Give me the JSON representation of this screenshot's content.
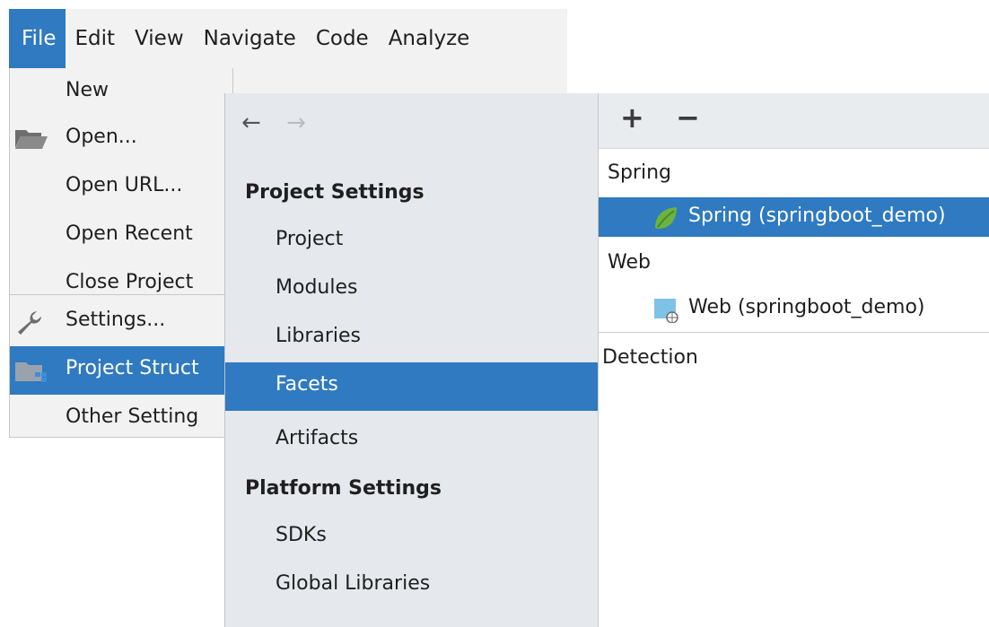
{
  "menubar": {
    "items": [
      "File",
      "Edit",
      "View",
      "Navigate",
      "Code",
      "Analyze"
    ]
  },
  "file_menu": {
    "new_label": "New",
    "open_label": "Open...",
    "open_url_label": "Open URL...",
    "open_recent_label": "Open Recent",
    "close_project_label": "Close Project",
    "settings_label": "Settings...",
    "project_structure_label": "Project Struct",
    "other_settings_label": "Other Setting",
    "submenu_arrow": ">"
  },
  "project_structure": {
    "back_arrow": "←",
    "forward_arrow": "→",
    "project_settings_heading": "Project Settings",
    "project_settings_items": [
      "Project",
      "Modules",
      "Libraries",
      "Facets",
      "Artifacts"
    ],
    "selected_item": "Facets",
    "platform_settings_heading": "Platform Settings",
    "platform_settings_items": [
      "SDKs",
      "Global Libraries"
    ]
  },
  "facets_panel": {
    "add_button": "+",
    "remove_button": "−",
    "groups": [
      {
        "name": "Spring",
        "item": "Spring (springboot_demo)"
      },
      {
        "name": "Web",
        "item": "Web (springboot_demo)"
      }
    ],
    "detection_label": "Detection"
  },
  "colors": {
    "selection": "#2f7ac0",
    "menu_bg": "#f2f2f2",
    "nav_bg": "#e5e8ec",
    "spring_green": "#6db33f",
    "web_blue": "#7fc2e8"
  }
}
